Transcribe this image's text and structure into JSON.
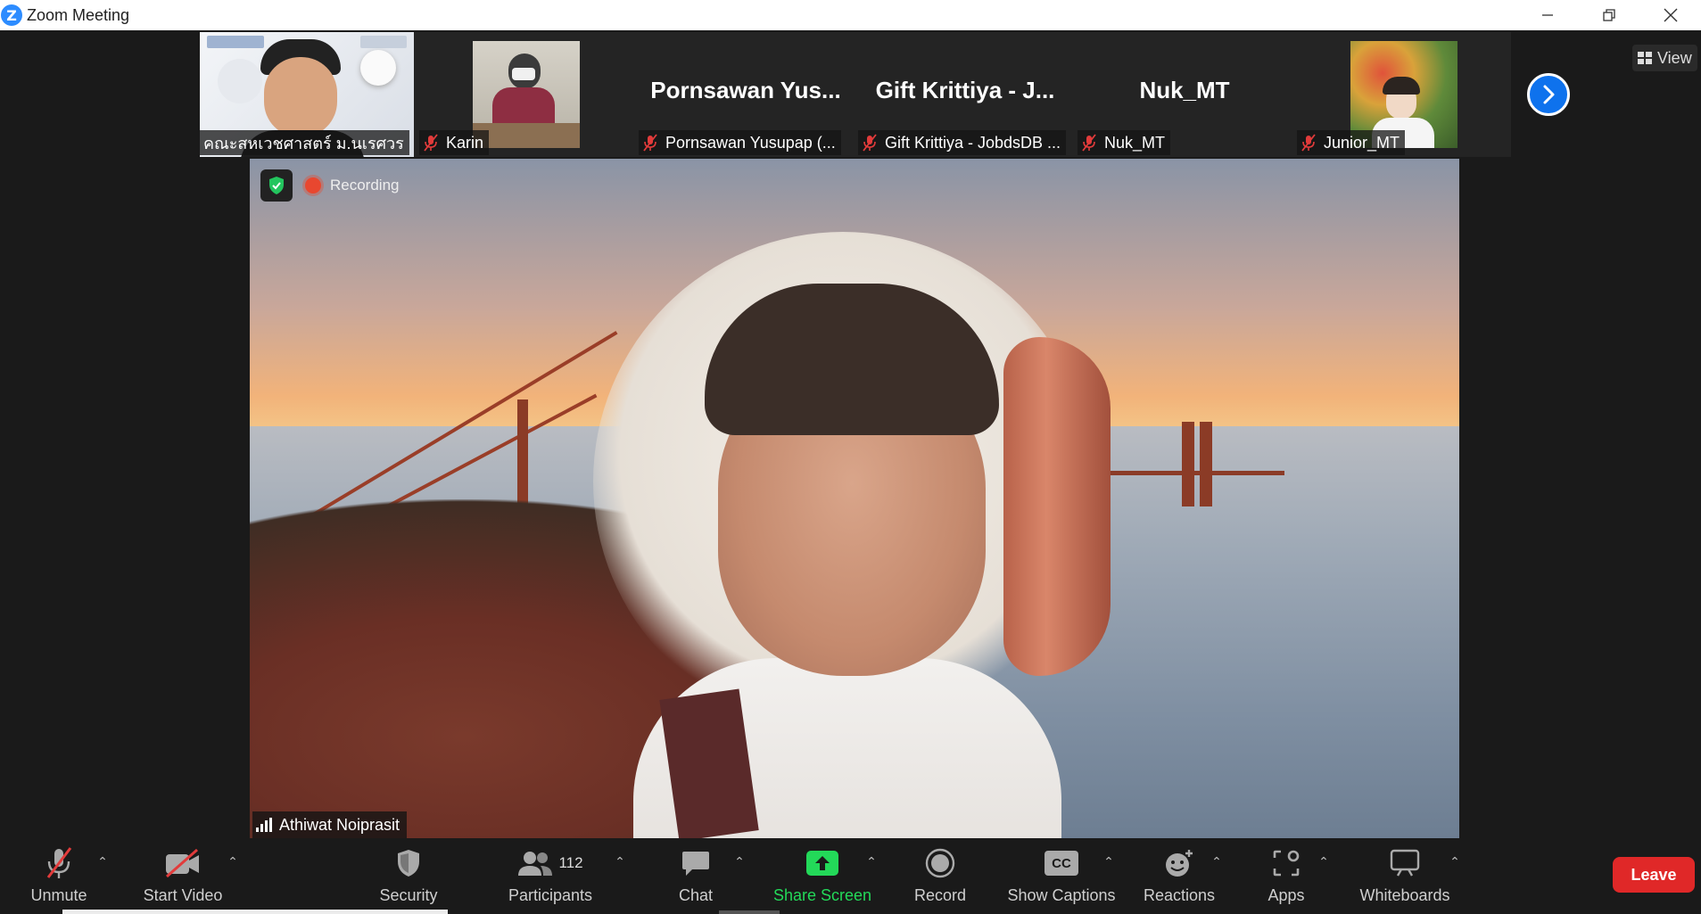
{
  "window": {
    "title": "Zoom Meeting",
    "logo_letter": "Z"
  },
  "thumbnails": [
    {
      "label": "คณะสหเวชศาสตร์ ม.นเรศวร",
      "display_name": "",
      "muted": false,
      "has_video": true
    },
    {
      "label": "Karin",
      "display_name": "",
      "muted": true,
      "has_video": true
    },
    {
      "label": "Pornsawan Yusupap (...",
      "display_name": "Pornsawan  Yus...",
      "muted": true,
      "has_video": false
    },
    {
      "label": "Gift Krittiya - JobdsDB ...",
      "display_name": "Gift Krittiya - J...",
      "muted": true,
      "has_video": false
    },
    {
      "label": "Nuk_MT",
      "display_name": "Nuk_MT",
      "muted": true,
      "has_video": false
    },
    {
      "label": "Junior_MT",
      "display_name": "",
      "muted": true,
      "has_video": true
    }
  ],
  "view_button": {
    "label": "View"
  },
  "main_video": {
    "recording_label": "Recording",
    "speaker_name": "Athiwat Noiprasit"
  },
  "toolbar": {
    "unmute": "Unmute",
    "start_video": "Start Video",
    "security": "Security",
    "participants": "Participants",
    "participant_count": "112",
    "chat": "Chat",
    "share_screen": "Share Screen",
    "record": "Record",
    "show_captions": "Show Captions",
    "captions_icon_text": "CC",
    "reactions": "Reactions",
    "apps": "Apps",
    "whiteboards": "Whiteboards",
    "leave": "Leave"
  },
  "colors": {
    "accent_blue": "#0e72ed",
    "share_green": "#23d959",
    "leave_red": "#e02828",
    "recording_red": "#e8472f",
    "security_green": "#23c55e"
  }
}
